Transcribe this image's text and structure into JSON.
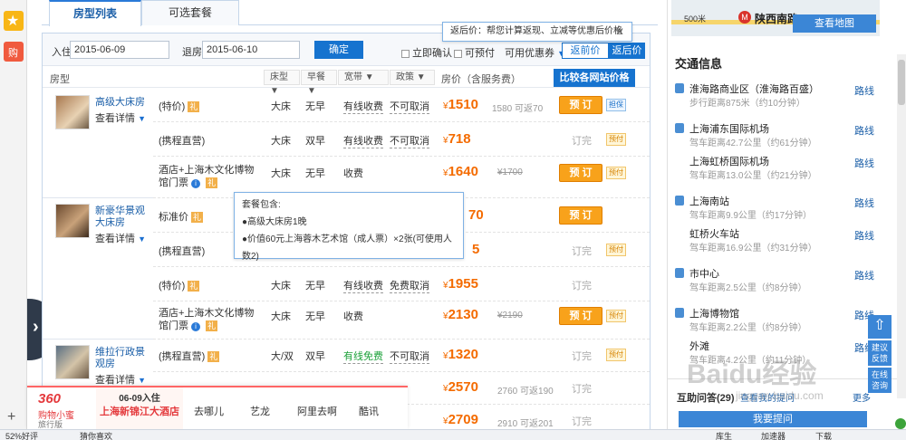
{
  "tabs": [
    "房型列表",
    "可选套餐"
  ],
  "filter": {
    "checkin_label": "入住",
    "checkin": "2015-06-09",
    "checkout_label": "退房",
    "checkout": "2015-06-10",
    "confirm": "确定",
    "instant": "立即确认",
    "prepay": "可预付",
    "coupon": "可用优惠券",
    "before": "返前价",
    "after": "返后价"
  },
  "tooltip_top": "返后价：帮您计算返现、立减等优惠后价格",
  "columns": {
    "room": "房型",
    "bed": "床型",
    "breakfast": "早餐",
    "broadband": "宽带",
    "policy": "政策",
    "price": "房价（含服务费）",
    "compare": "比较各网站价格"
  },
  "room_groups": [
    {
      "name": "高级大床房",
      "detail": "查看详情"
    },
    {
      "name": "新豪华景观大床房",
      "detail": "查看详情"
    },
    {
      "name": "维拉行政景观房",
      "detail": "查看详情"
    }
  ],
  "rows": [
    {
      "name": "(特价)",
      "gift": "礼",
      "bed": "大床",
      "bf": "无早",
      "bb": "有线收费",
      "policy": "不可取消",
      "price": "1510",
      "orig": "1580 可返70",
      "action": "预 订",
      "tag": "担保"
    },
    {
      "name": "(携程直营)",
      "bed": "大床",
      "bf": "双早",
      "bb": "有线收费",
      "policy": "不可取消",
      "price": "718",
      "action": "订完",
      "tag": "预付"
    },
    {
      "name": "酒店+上海木文化博物馆门票",
      "bed": "大床",
      "bf": "无早",
      "bb": "收费",
      "price": "1640",
      "orig": "¥1700",
      "action": "预 订",
      "tag": "预付"
    },
    {
      "name": "标准价",
      "gift": "礼",
      "price": "70",
      "action": "预 订"
    },
    {
      "name": "(携程直营)",
      "price": "5",
      "action": "订完",
      "tag": "预付"
    },
    {
      "name": "(特价)",
      "gift": "礼",
      "bed": "大床",
      "bf": "无早",
      "bb": "有线收费",
      "policy": "免费取消",
      "price": "1955",
      "action": "订完"
    },
    {
      "name": "酒店+上海木文化博物馆门票",
      "bed": "大床",
      "bf": "无早",
      "bb": "收费",
      "price": "2130",
      "orig": "¥2190",
      "action": "预 订",
      "tag": "预付"
    },
    {
      "name": "(携程直营)",
      "gift": "礼",
      "bed": "大/双",
      "bf": "双早",
      "bb": "有线免费",
      "policy": "不可取消",
      "price": "1320",
      "action": "订完",
      "tag": "预付"
    },
    {
      "price": "2570",
      "orig": "2760 可返190",
      "action": "订完"
    },
    {
      "price": "2709",
      "orig": "2910 可返201",
      "action": "订完"
    }
  ],
  "tooltip_pkg": {
    "title": "套餐包含:",
    "l1": "●高级大床房1晚",
    "l2": "●价值60元上海蓉木艺术馆（成人票）×2张(可使用人数2)"
  },
  "map": {
    "scale": "500米",
    "station": "陕西南路",
    "button": "查看地图"
  },
  "traffic": {
    "title": "交通信息",
    "link": "路线",
    "items": [
      {
        "name": "淮海路商业区（淮海路百盛）",
        "dist": "步行距离875米（约10分钟）"
      },
      {
        "name": "上海浦东国际机场",
        "dist": "驾车距离42.7公里（约61分钟）"
      },
      {
        "name": "上海虹桥国际机场",
        "dist": "驾车距离13.0公里（约21分钟）"
      },
      {
        "name": "上海南站",
        "dist": "驾车距离9.9公里（约17分钟）"
      },
      {
        "name": "虹桥火车站",
        "dist": "驾车距离16.9公里（约31分钟）"
      },
      {
        "name": "市中心",
        "dist": "驾车距离2.5公里（约8分钟）"
      },
      {
        "name": "上海博物馆",
        "dist": "驾车距离2.2公里（约8分钟）"
      },
      {
        "name": "外滩",
        "dist": "驾车距离4.2公里（约11分钟）"
      }
    ]
  },
  "qa": {
    "title": "互助问答(29)",
    "ask": "查看我的提问",
    "more": "更多",
    "button": "我要提问"
  },
  "side_buttons": [
    "建议反馈",
    "在线咨询"
  ],
  "bottom": {
    "logo": "360",
    "sub": "购物小蜜",
    "sub2": "旅行版",
    "date": "06-09入住",
    "hotel": "上海新锦江大酒店",
    "links": [
      "去哪儿",
      "艺龙",
      "阿里去啊",
      "酷讯"
    ]
  },
  "status": {
    "left": "52%好评",
    "mid": "猜你喜欢",
    "items": [
      "库生",
      "加速器",
      "下载"
    ]
  },
  "watermark": "Baidu经验",
  "watermark2": "jingyan.baidu.com",
  "colors": {
    "accent": "#1673cf",
    "price": "#f46b00",
    "book": "#f8a21b"
  }
}
